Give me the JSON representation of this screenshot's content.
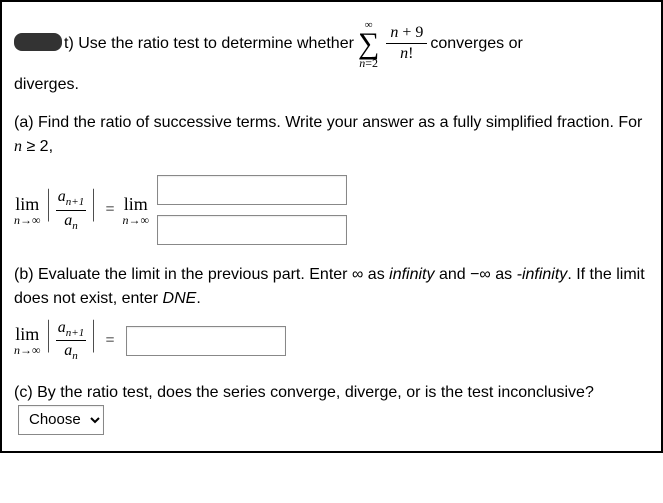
{
  "intro": {
    "prefix": "t) Use the ratio test to determine whether",
    "sigma_top": "∞",
    "sigma_bot_lhs": "n",
    "sigma_bot_eq": "=2",
    "frac_num_var": "n",
    "frac_num_op": " + 9",
    "frac_den_var": "n",
    "frac_den_bang": "!",
    "suffix1": "converges or",
    "suffix2": "diverges."
  },
  "partA": {
    "label": "(a) Find the ratio of successive terms. Write your answer as a fully simplified fraction. For ",
    "cond_var": "n",
    "cond_rest": " ≥ 2,",
    "lim_word": "lim",
    "lim_sub_n": "n",
    "lim_sub_arrow": "→∞",
    "ratio_num_a": "a",
    "ratio_num_sub": "n+1",
    "ratio_den_a": "a",
    "ratio_den_sub": "n",
    "eq": "="
  },
  "partB": {
    "text1": "(b) Evaluate the limit in the previous part. Enter ∞ as ",
    "inf_word": "infinity",
    "text2": " and −∞ as ",
    "neginf_word": "-infinity",
    "text3": ". If the limit does not exist, enter ",
    "dne": "DNE",
    "period": "."
  },
  "partC": {
    "text": "(c) By the ratio test, does the series converge, diverge, or is the test inconclusive?",
    "choose_label": "Choose"
  }
}
